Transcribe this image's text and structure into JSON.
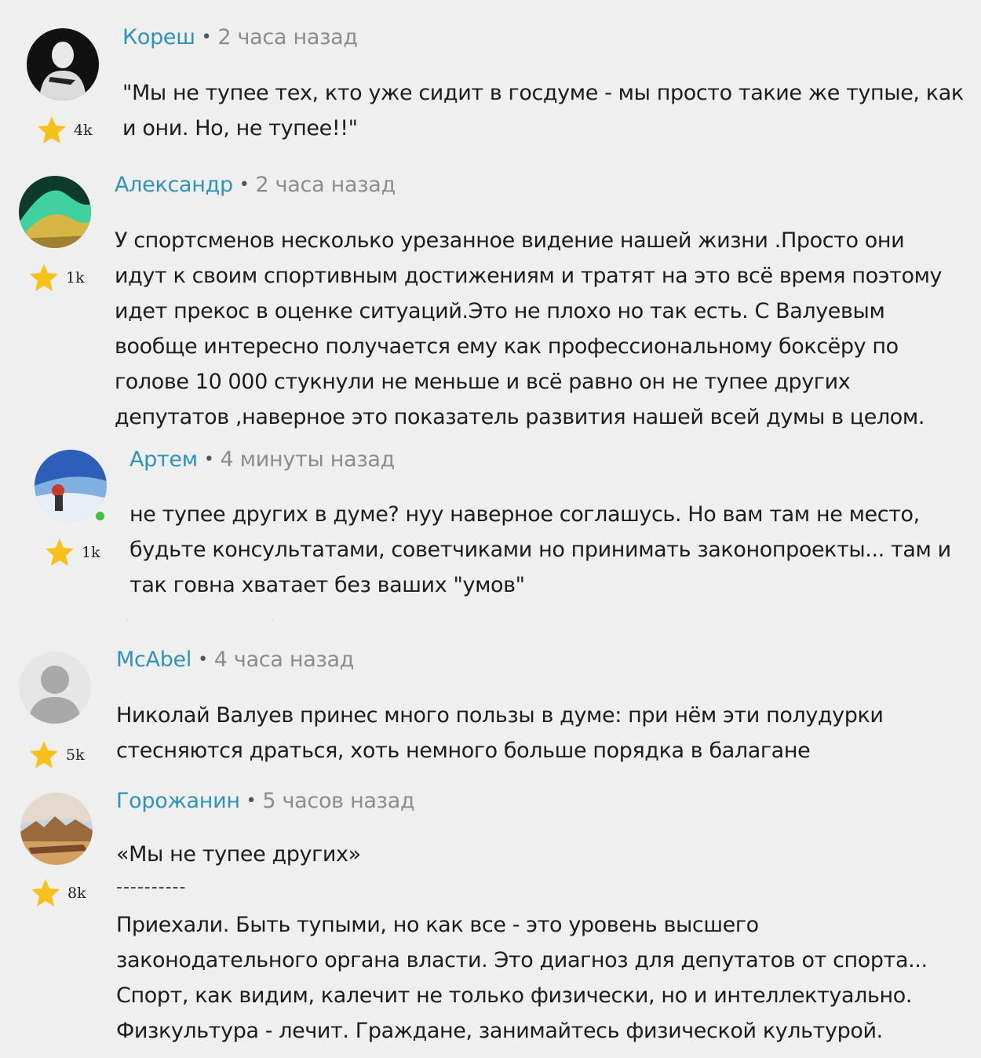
{
  "colors": {
    "author": "#2f93b8",
    "time": "#8c8c8c",
    "star": "#f6c21a",
    "background": "#efefef"
  },
  "comments": [
    {
      "author": "Кореш",
      "time": "2 часа назад",
      "rating": "4k",
      "lines": [
        "\"Мы не тупее тех, кто уже сидит в госдуме - мы просто такие же тупые, как",
        "и они. Но, не тупее!!\""
      ]
    },
    {
      "author": "Александр",
      "time": "2 часа назад",
      "rating": "1k",
      "lines": [
        "У спортсменов несколько урезанное видение нашей жизни .Просто они",
        "идут к своим спортивным достижениям и тратят на это всё время поэтому",
        "идет прекос в оценке ситуаций.Это не плохо но так есть. С Валуевым",
        "вообще интересно получается ему как профессиональному боксёру по",
        "голове 10 000 стукнули не меньше и всё равно он не тупее других",
        "депутатов ,наверное это показатель развития нашей всей думы в целом."
      ]
    },
    {
      "author": "Артем",
      "time": "4 минуты назад",
      "rating": "1k",
      "lines": [
        "не тупее других в думе? нуу наверное соглашусь. Но вам там не место,",
        "будьте консультатами, советчиками но принимать законопроекты... там и",
        "так говна хватает без ваших \"умов\""
      ]
    },
    {
      "author": "McAbel",
      "time": "4 часа назад",
      "rating": "5k",
      "lines": [
        "Николай Валуев принес много пользы в думе: при нём эти полудурки",
        "стесняются драться, хоть немного больше порядка в балагане"
      ]
    },
    {
      "author": "Горожанин",
      "time": "5 часов назад",
      "rating": "8k",
      "quote": "«Мы не тупее других»",
      "separator": "----------",
      "lines": [
        "Приехали. Быть тупыми, но как все - это уровень высшего",
        "законодательного органа власти. Это диагноз для депутатов от спорта...",
        "Спорт, как видим, калечит не только физически, но и интеллектуально.",
        "Физкультура - лечит. Граждане, занимайтесь физической культурой."
      ]
    }
  ]
}
